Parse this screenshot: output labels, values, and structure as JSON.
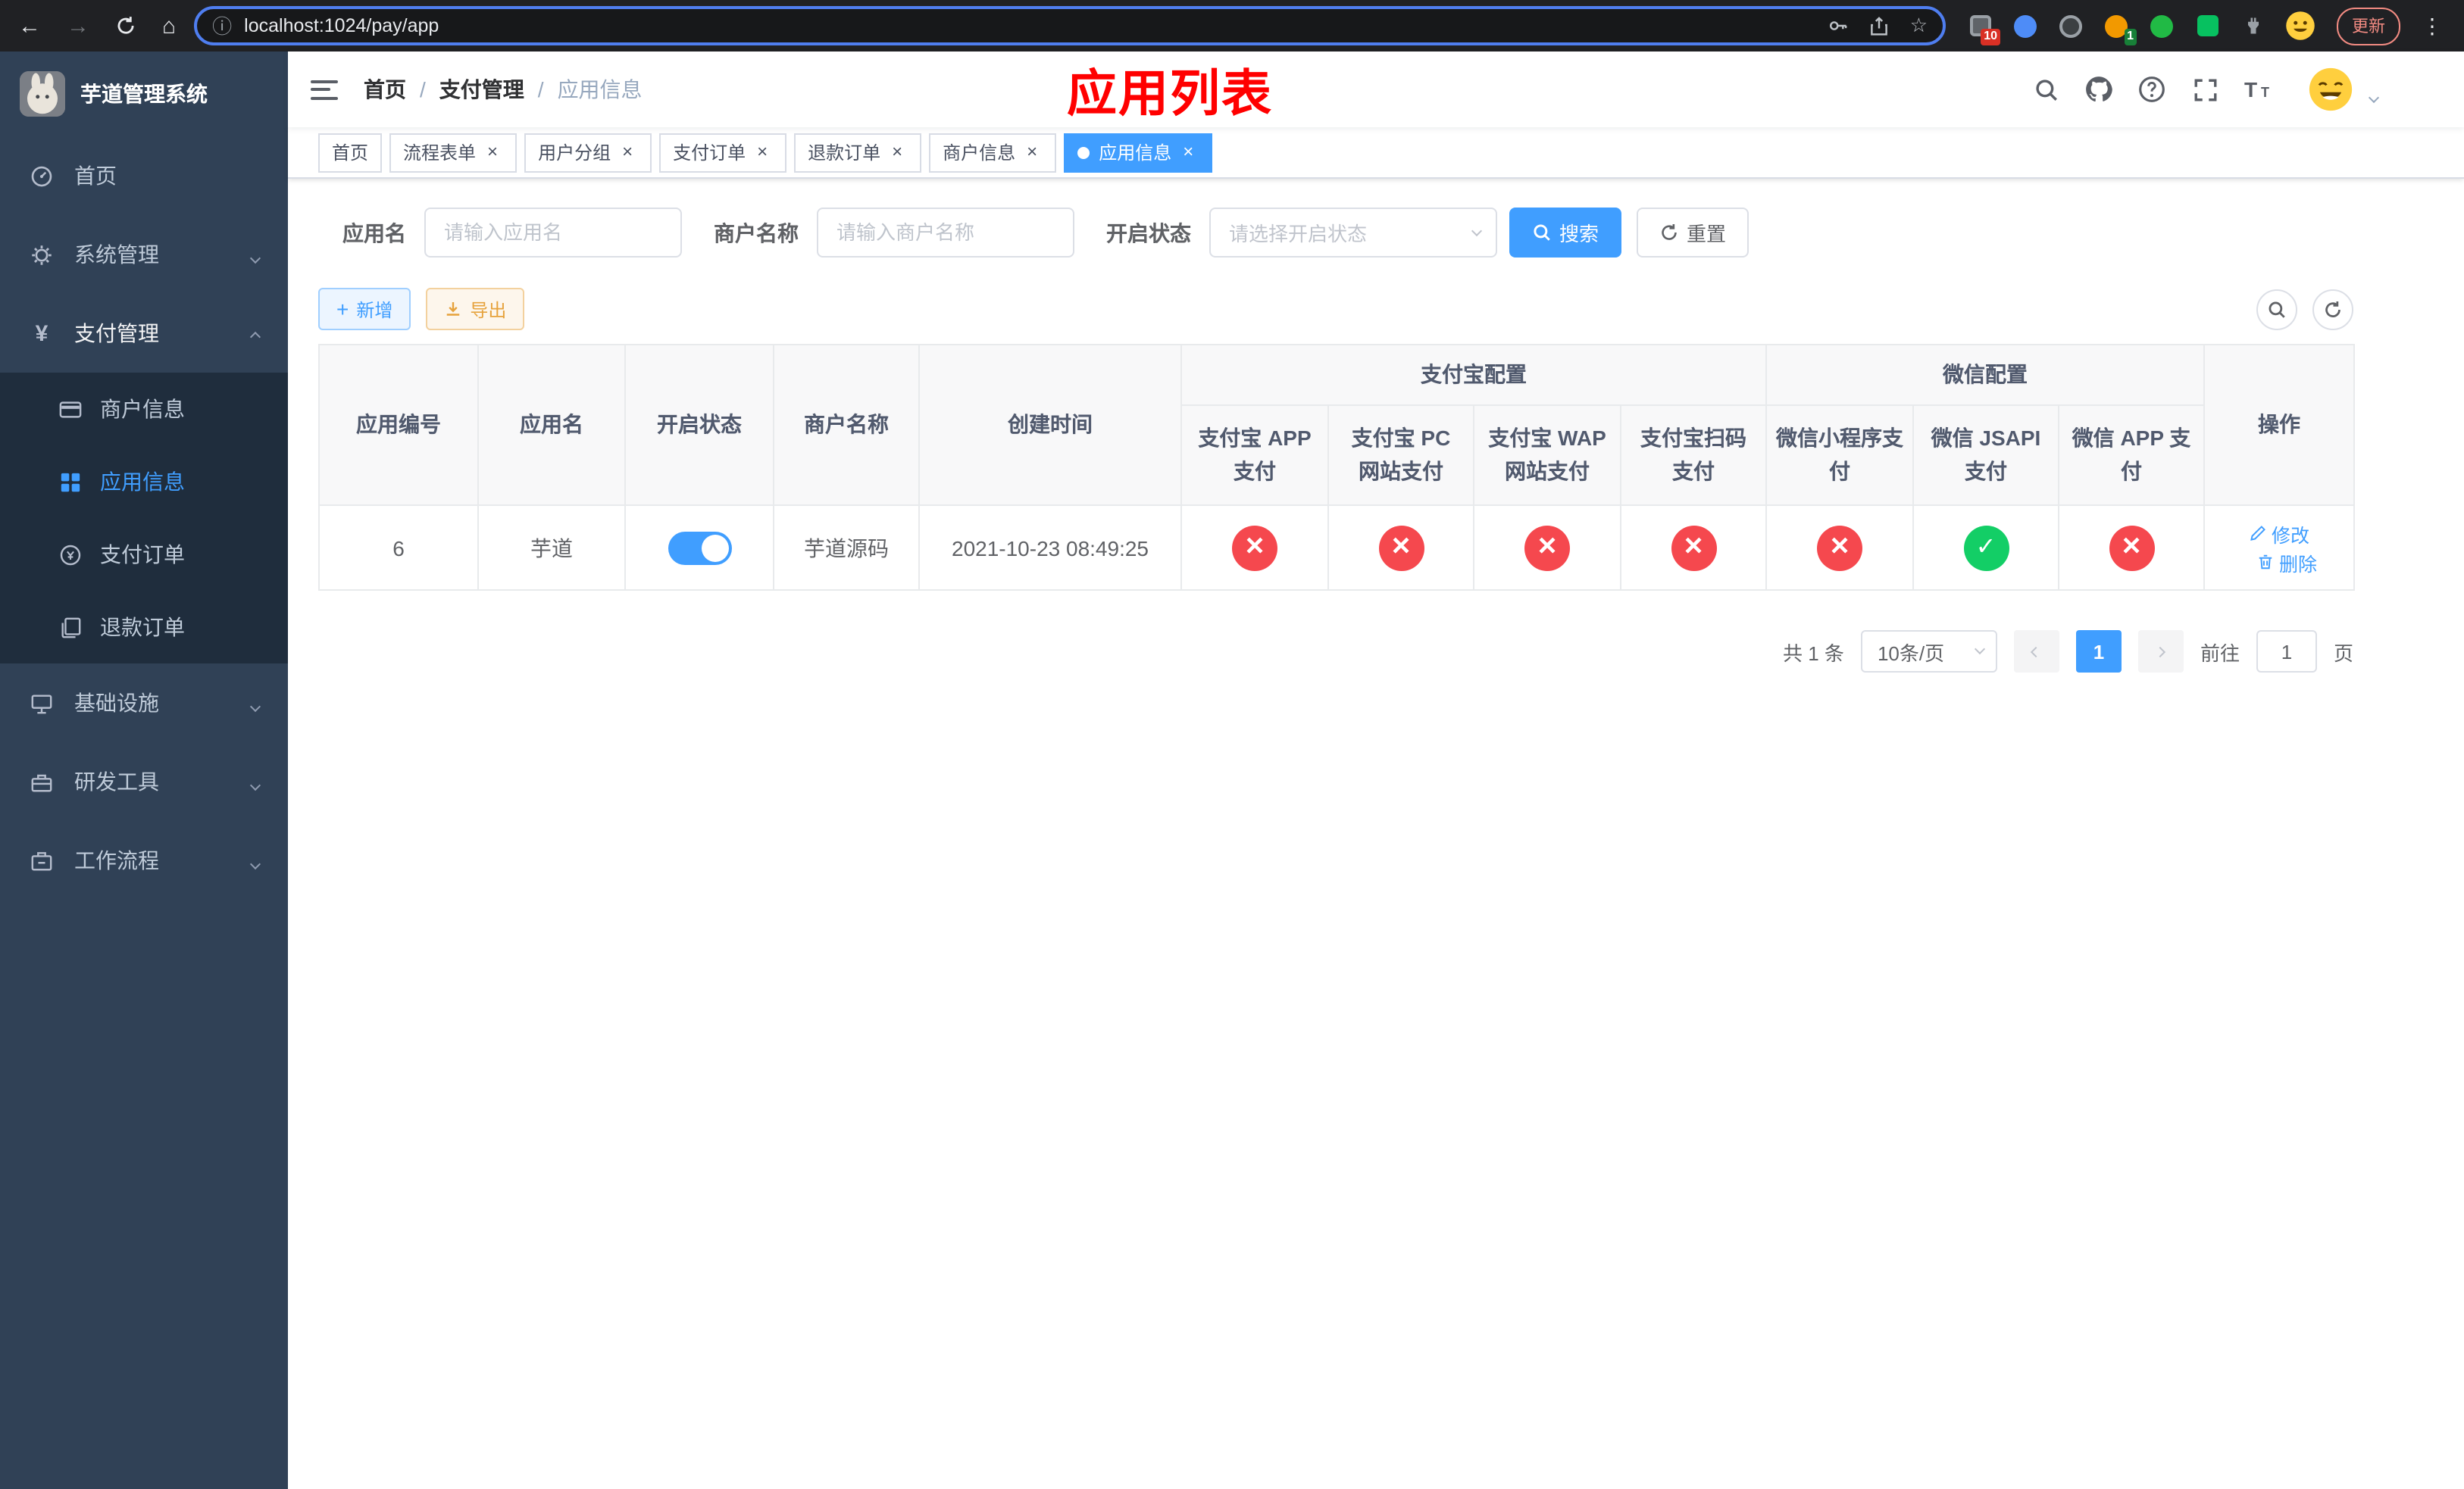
{
  "browser": {
    "url": "localhost:1024/pay/app",
    "update_label": "更新",
    "extension_badge_1": "10",
    "extension_badge_2": "1"
  },
  "sidebar": {
    "title": "芋道管理系统",
    "menu": [
      {
        "label": "首页"
      },
      {
        "label": "系统管理"
      },
      {
        "label": "支付管理"
      },
      {
        "label": "商户信息"
      },
      {
        "label": "应用信息"
      },
      {
        "label": "支付订单"
      },
      {
        "label": "退款订单"
      },
      {
        "label": "基础设施"
      },
      {
        "label": "研发工具"
      },
      {
        "label": "工作流程"
      }
    ]
  },
  "header": {
    "breadcrumb": [
      "首页",
      "支付管理",
      "应用信息"
    ],
    "page_title": "应用列表"
  },
  "tabs": [
    {
      "label": "首页"
    },
    {
      "label": "流程表单"
    },
    {
      "label": "用户分组"
    },
    {
      "label": "支付订单"
    },
    {
      "label": "退款订单"
    },
    {
      "label": "商户信息"
    },
    {
      "label": "应用信息"
    }
  ],
  "filters": {
    "app_name_label": "应用名",
    "app_name_placeholder": "请输入应用名",
    "merchant_label": "商户名称",
    "merchant_placeholder": "请输入商户名称",
    "status_label": "开启状态",
    "status_placeholder": "请选择开启状态",
    "search_label": "搜索",
    "reset_label": "重置"
  },
  "toolbar": {
    "add_label": "新增",
    "export_label": "导出"
  },
  "table": {
    "groups": {
      "alipay": "支付宝配置",
      "wechat": "微信配置"
    },
    "columns": {
      "id": "应用编号",
      "name": "应用名",
      "status": "开启状态",
      "merchant": "商户名称",
      "created": "创建时间",
      "alipay_app": "支付宝 APP 支付",
      "alipay_pc": "支付宝 PC 网站支付",
      "alipay_wap": "支付宝 WAP 网站支付",
      "alipay_qr": "支付宝扫码支付",
      "wechat_lite": "微信小程序支付",
      "wechat_jsapi": "微信 JSAPI 支付",
      "wechat_app": "微信 APP 支付",
      "actions": "操作"
    },
    "rows": [
      {
        "id": "6",
        "name": "芋道",
        "enabled": true,
        "merchant": "芋道源码",
        "created": "2021-10-23 08:49:25",
        "config": {
          "alipay_app": false,
          "alipay_pc": false,
          "alipay_wap": false,
          "alipay_qr": false,
          "wechat_lite": false,
          "wechat_jsapi": true,
          "wechat_app": false
        },
        "actions": {
          "edit": "修改",
          "delete": "删除"
        }
      }
    ]
  },
  "pagination": {
    "total": "共 1 条",
    "page_size": "10条/页",
    "page": "1",
    "goto_label": "前往",
    "goto_value": "1",
    "goto_unit": "页"
  },
  "icons": {
    "yen": "¥",
    "star": "☆",
    "info": "ⓘ",
    "back": "←",
    "forward": "→",
    "home": "⌂",
    "kebab": "⋮"
  },
  "colors": {
    "primary": "#409eff",
    "success": "#13ce66",
    "danger": "#f5484e",
    "warning": "#e6a23c",
    "sidebar_bg": "#304156",
    "sidebar_sub_bg": "#1f2d3d",
    "title_red": "#ff0000",
    "chrome_bg": "#202124"
  }
}
